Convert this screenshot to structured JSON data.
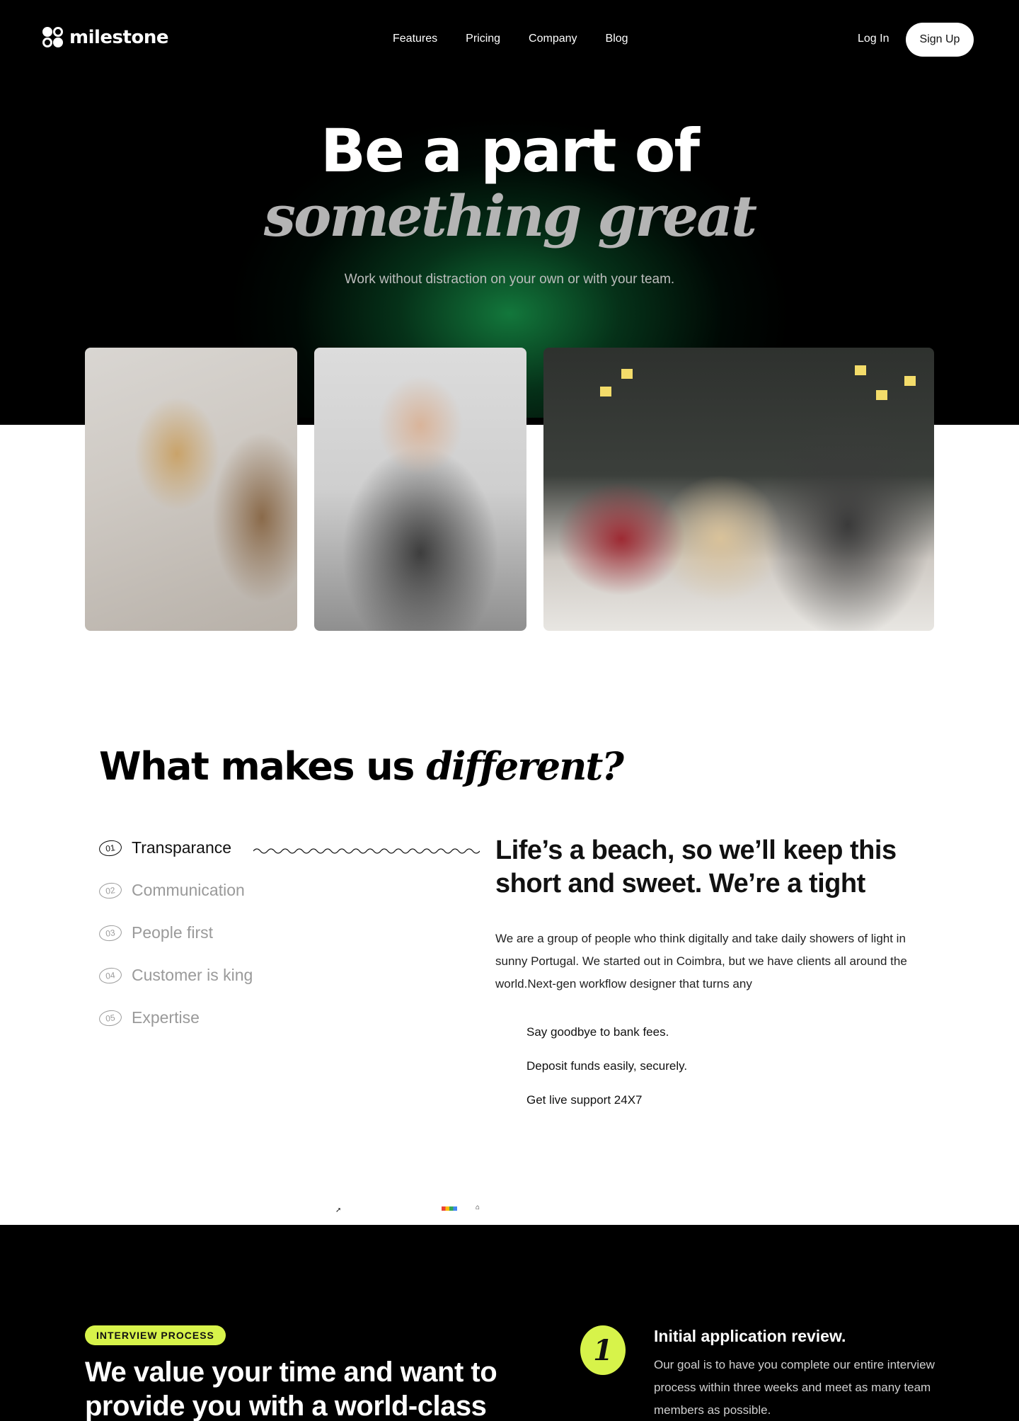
{
  "brand": {
    "name": "milestone"
  },
  "nav": {
    "links": [
      "Features",
      "Pricing",
      "Company",
      "Blog"
    ],
    "login_label": "Log In",
    "signup_label": "Sign Up"
  },
  "hero": {
    "title_line1": "Be a part of",
    "title_line2": "something great",
    "subtitle": "Work without distraction on your own or with your team."
  },
  "different": {
    "title_prefix": "What makes us ",
    "title_emphasis": "different?",
    "features": [
      {
        "num": "01",
        "label": "Transparance",
        "active": true
      },
      {
        "num": "02",
        "label": "Communication",
        "active": false
      },
      {
        "num": "03",
        "label": "People first",
        "active": false
      },
      {
        "num": "04",
        "label": "Customer is king",
        "active": false
      },
      {
        "num": "05",
        "label": "Expertise",
        "active": false
      }
    ],
    "detail_title": "Life’s a beach, so we’ll keep this short and sweet. We’re a tight",
    "detail_body": "We are a group of people who think digitally and take daily showers of light in sunny Portugal. We started out in Coimbra, but we have clients all around the world.Next-gen workflow designer that turns any",
    "bullets": [
      "Say goodbye to bank fees.",
      "Deposit funds easily, securely.",
      "Get live support 24X7"
    ]
  },
  "interview": {
    "pill": "INTERVIEW PROCESS",
    "title": "We value your time and want to provide you with a world-class",
    "step_number": "1",
    "step_title": "Initial application review.",
    "step_body": "Our goal is to have you complete our entire interview process within three weeks and meet as many team members as possible."
  },
  "colors": {
    "accent": "#d7f34a",
    "hero_bg": "#000000",
    "glow": "#168c46"
  }
}
